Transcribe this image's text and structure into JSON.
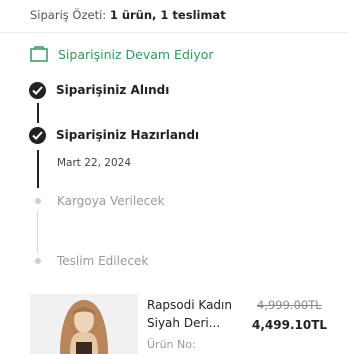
{
  "order_summary": {
    "label": "Sipariş Özeti:",
    "value": "1 ürün, 1 teslimat"
  },
  "status": {
    "text": "Siparişiniz Devam Ediyor",
    "icon": "package-icon",
    "color": "#2e9b5b"
  },
  "timeline": {
    "steps": [
      {
        "label": "Siparişiniz Alındı",
        "state": "done"
      },
      {
        "label": "Siparişiniz Hazırlandı",
        "state": "done",
        "date": "Mart 22, 2024"
      },
      {
        "label": "Kargoya Verilecek",
        "state": "pending"
      },
      {
        "label": "Teslim Edilecek",
        "state": "pending"
      }
    ]
  },
  "product": {
    "name_line1": "Rapsodi Kadın",
    "name_line2": "Siyah Deri...",
    "old_price": "4,999.00TL",
    "new_price": "4,499.10TL",
    "meta_label": "Ürün No:"
  }
}
